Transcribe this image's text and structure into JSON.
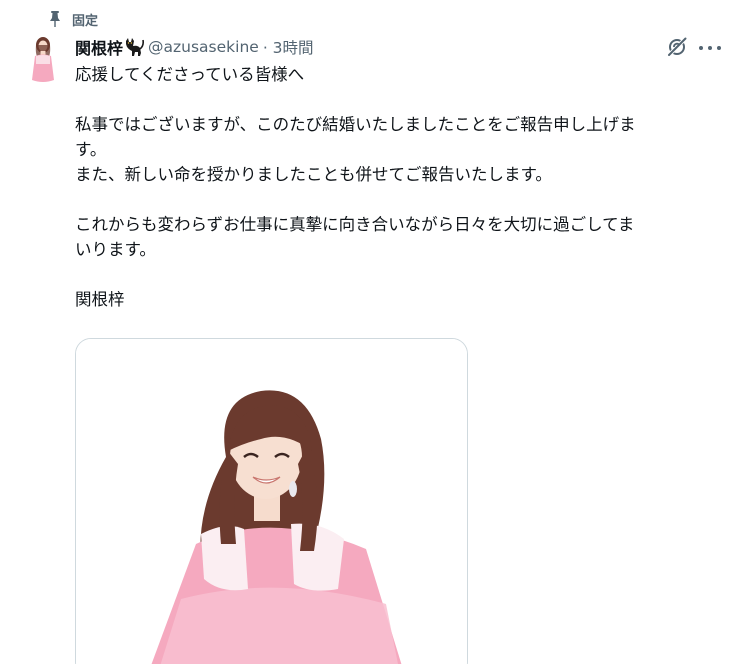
{
  "pinned": {
    "label": "固定",
    "icon": "pin-icon"
  },
  "author": {
    "name": "関根梓",
    "handle": "@azusasekine",
    "time": "· 3時間",
    "emoji_icon": "black-cat-icon"
  },
  "actions": {
    "grok_icon": "grok-icon",
    "more_icon": "more-icon"
  },
  "tweet": {
    "lines": [
      "応援してくださっている皆様へ",
      "",
      "私事ではございますが、このたび結婚いたしましたことをご報告申し上げま",
      "す。",
      "また、新しい命を授かりましたことも併せてご報告いたします。",
      "",
      "これからも変わらずお仕事に真摯に向き合いながら日々を大切に過ごしてま",
      "いります。",
      "",
      "関根梓"
    ]
  },
  "colors": {
    "text": "#0f1419",
    "secondary": "#536471",
    "border": "#cfd9de",
    "dress": "#f5a9bf",
    "hair": "#6b3a2e"
  }
}
